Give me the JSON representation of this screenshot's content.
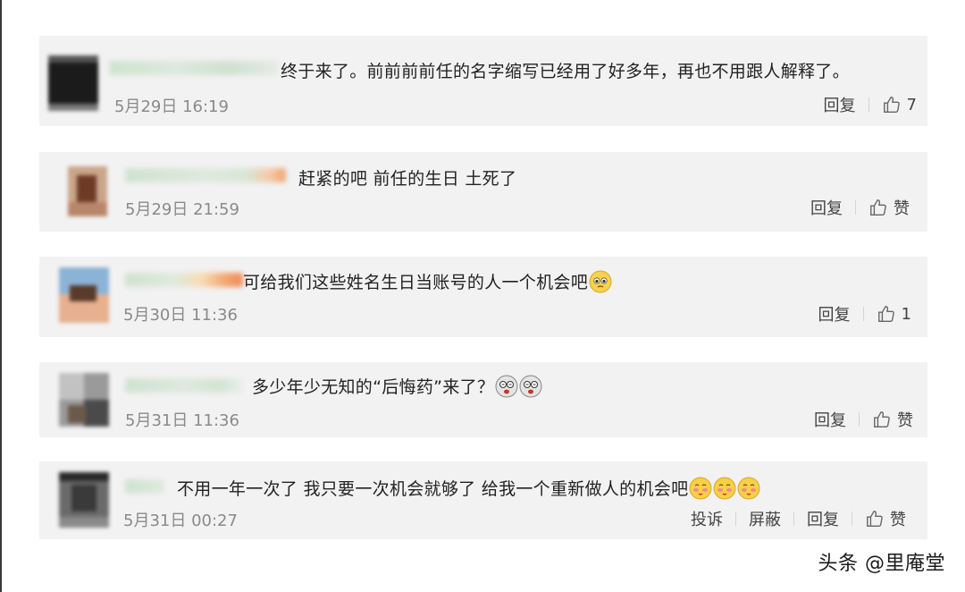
{
  "comments": [
    {
      "text": "终于来了。前前前前任的名字缩写已经用了好多年，再也不用跟人解释了。",
      "time": "5月29日 16:19",
      "reply_label": "回复",
      "like_count": "7"
    },
    {
      "text": "赶紧的吧  前任的生日  土死了",
      "time": "5月29日 21:59",
      "reply_label": "回复",
      "like_count": "赞"
    },
    {
      "text": "可给我们这些姓名生日当账号的人一个机会吧",
      "time": "5月30日 11:36",
      "reply_label": "回复",
      "like_count": "1"
    },
    {
      "text": "多少年少无知的“后悔药”来了？",
      "time": "5月31日 11:36",
      "reply_label": "回复",
      "like_count": "赞"
    },
    {
      "text": "不用一年一次了 我只要一次机会就够了 给我一个重新做人的机会吧",
      "time": "5月31日 00:27",
      "report_label": "投诉",
      "block_label": "屏蔽",
      "reply_label": "回复",
      "like_count": "赞"
    }
  ],
  "emoji": {
    "pleading": "pleading-emoji",
    "dizzy": "dizzy-face-emoji",
    "blush": "blushing-emoji"
  },
  "watermark": "头条 @里庵堂",
  "colors": {
    "card_bg": "#f2f2f2",
    "time_text": "#8a8a8a",
    "body_text": "#222222"
  }
}
